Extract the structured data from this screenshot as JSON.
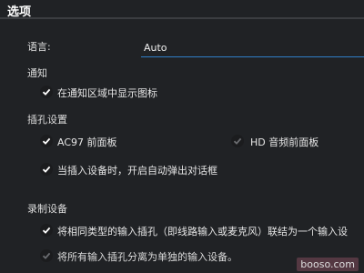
{
  "header": {
    "title": "选项"
  },
  "language": {
    "label": "语言:",
    "value": "Auto"
  },
  "notify": {
    "section": "通知",
    "options": [
      {
        "label": "在通知区域中显示图标",
        "checked": true
      }
    ]
  },
  "jack": {
    "section": "插孔设置",
    "options": [
      {
        "label": "AC97 前面板",
        "checked": true
      },
      {
        "label": "HD 音频前面板",
        "checked": false
      },
      {
        "label": "当插入设备时，开启自动弹出对话框",
        "checked": true
      }
    ]
  },
  "record": {
    "section": "录制设备",
    "options": [
      {
        "label": "将相同类型的输入插孔（即线路输入或麦克风）联结为一个输入设",
        "checked": true
      },
      {
        "label": "将所有输入插孔分离为单独的输入设备。",
        "checked": false
      }
    ]
  },
  "watermark": "booso.com",
  "colors": {
    "background": "#202225",
    "accent": "#2f7ec7"
  }
}
